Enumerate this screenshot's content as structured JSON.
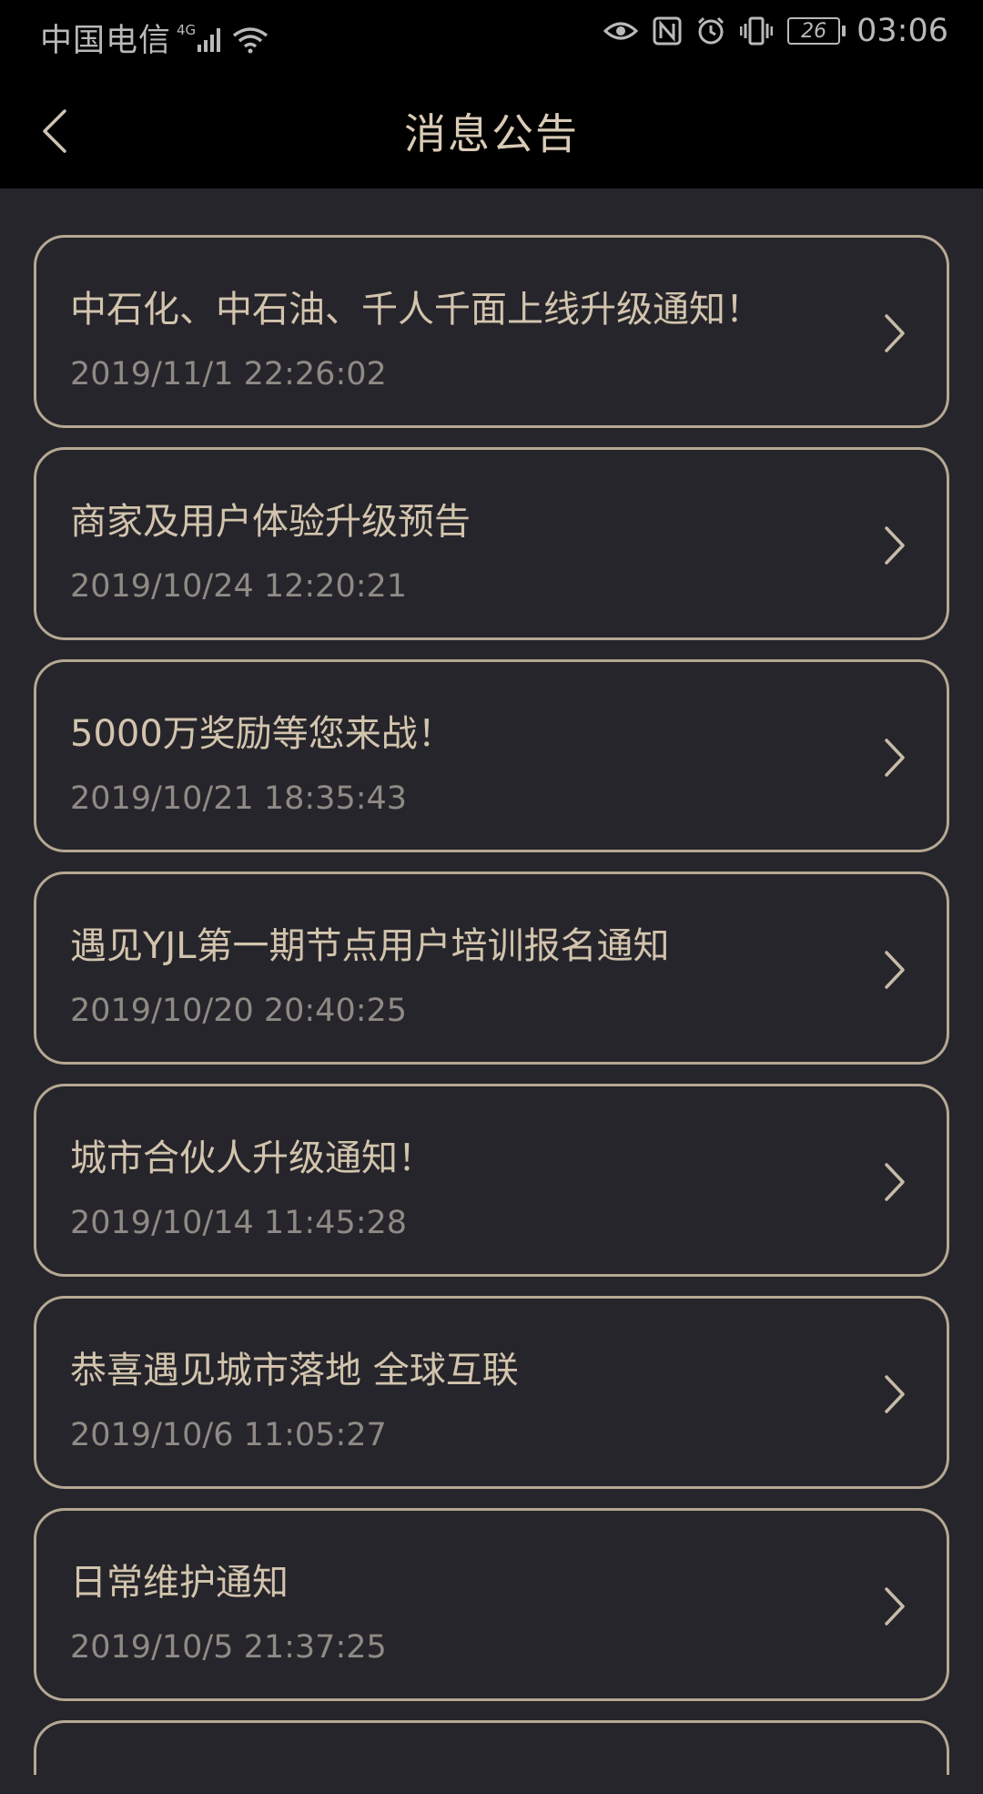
{
  "status_bar": {
    "carrier": "中国电信",
    "network_type": "4G",
    "battery_level": "26",
    "time": "03:06",
    "icons": [
      "signal-icon",
      "wifi-icon",
      "eye-icon",
      "nfc-icon",
      "alarm-icon",
      "vibrate-icon",
      "battery-icon"
    ]
  },
  "header": {
    "title": "消息公告",
    "back_icon": "chevron-left-icon"
  },
  "notices": [
    {
      "title": "中石化、中石油、千人千面上线升级通知！",
      "date": "2019/11/1 22:26:02"
    },
    {
      "title": "商家及用户体验升级预告",
      "date": "2019/10/24 12:20:21"
    },
    {
      "title": "5000万奖励等您来战！",
      "date": "2019/10/21 18:35:43"
    },
    {
      "title": "遇见YJL第一期节点用户培训报名通知",
      "date": "2019/10/20 20:40:25"
    },
    {
      "title": "城市合伙人升级通知！",
      "date": "2019/10/14 11:45:28"
    },
    {
      "title": "恭喜遇见城市落地 全球互联",
      "date": "2019/10/6 11:05:27"
    },
    {
      "title": "日常维护通知",
      "date": "2019/10/5 21:37:25"
    }
  ],
  "colors": {
    "background": "#26252b",
    "header": "#000000",
    "accent_border": "#b5a893",
    "title_text": "#d2c4ad",
    "date_text": "#8f8a85"
  }
}
